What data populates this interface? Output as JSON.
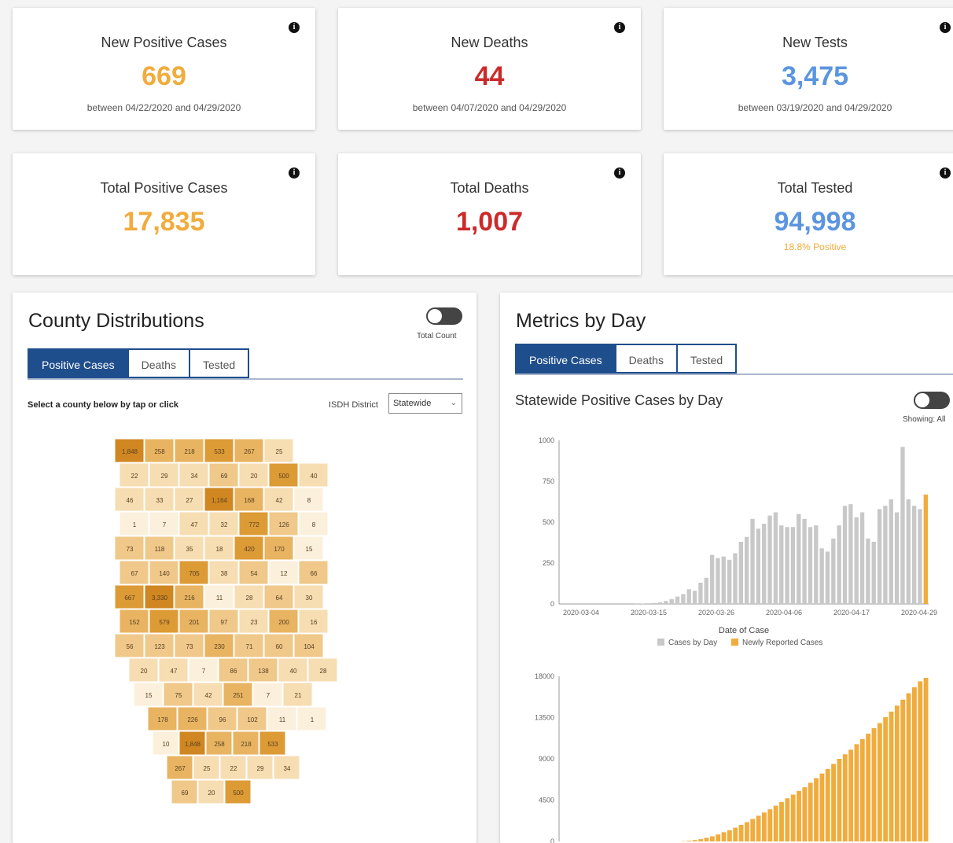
{
  "stats": [
    {
      "title": "New Positive Cases",
      "value": "669",
      "sub": "between 04/22/2020 and 04/29/2020",
      "color": "#f0ac3c"
    },
    {
      "title": "New Deaths",
      "value": "44",
      "sub": "between 04/07/2020 and 04/29/2020",
      "color": "#cc2a2a"
    },
    {
      "title": "New Tests",
      "value": "3,475",
      "sub": "between 03/19/2020 and 04/29/2020",
      "color": "#5b95e0"
    },
    {
      "title": "Total Positive Cases",
      "value": "17,835",
      "sub": "",
      "color": "#f0ac3c"
    },
    {
      "title": "Total Deaths",
      "value": "1,007",
      "sub": "",
      "color": "#cc2a2a"
    },
    {
      "title": "Total Tested",
      "value": "94,998",
      "sub": "18.8% Positive",
      "color": "#5b95e0"
    }
  ],
  "info_icon": "i",
  "county": {
    "title": "County Distributions",
    "toggle_label": "Total Count",
    "tabs": [
      "Positive Cases",
      "Deaths",
      "Tested"
    ],
    "active_tab": 0,
    "instruction": "Select a county below by tap or click",
    "district_label": "ISDH District",
    "district_value": "Statewide",
    "map_labels": [
      "1,848",
      "258",
      "218",
      "533",
      "267",
      "25",
      "22",
      "29",
      "34",
      "69",
      "20",
      "500",
      "40",
      "46",
      "33",
      "27",
      "1,164",
      "168",
      "42",
      "8",
      "1",
      "7",
      "47",
      "32",
      "772",
      "126",
      "8",
      "73",
      "118",
      "35",
      "18",
      "420",
      "170",
      "15",
      "67",
      "140",
      "705",
      "38",
      "54",
      "12",
      "66",
      "667",
      "3,330",
      "216",
      "11",
      "28",
      "64",
      "30",
      "152",
      "579",
      "201",
      "97",
      "23",
      "200",
      "16",
      "56",
      "123",
      "73",
      "230",
      "71",
      "60",
      "104",
      "20",
      "47",
      "7",
      "86",
      "138",
      "40",
      "28",
      "15",
      "75",
      "42",
      "251",
      "7",
      "21",
      "178",
      "226",
      "96",
      "102",
      "11",
      "1",
      "10"
    ]
  },
  "metrics": {
    "title": "Metrics by Day",
    "tabs": [
      "Positive Cases",
      "Deaths",
      "Tested"
    ],
    "active_tab": 0,
    "chart_title": "Statewide Positive Cases by Day",
    "toggle_label": "Showing: All"
  },
  "chart_data": [
    {
      "type": "bar",
      "title": "Statewide Positive Cases by Day",
      "xlabel": "Date of Case",
      "ylabel": "",
      "ylim": [
        0,
        1000
      ],
      "yticks": [
        0,
        250,
        500,
        750,
        1000
      ],
      "xticks": [
        "2020-03-04",
        "2020-03-15",
        "2020-03-26",
        "2020-04-06",
        "2020-04-17",
        "2020-04-29"
      ],
      "x_start": "2020-03-02",
      "x_end": "2020-04-29",
      "series": [
        {
          "name": "Cases by Day",
          "color": "#c8c8c8",
          "values": [
            0,
            0,
            0,
            0,
            0,
            0,
            0,
            0,
            0,
            0,
            0,
            0,
            0,
            1,
            2,
            4,
            6,
            10,
            18,
            30,
            45,
            60,
            90,
            80,
            130,
            160,
            300,
            280,
            290,
            270,
            310,
            380,
            410,
            520,
            460,
            490,
            540,
            560,
            480,
            470,
            470,
            550,
            520,
            470,
            480,
            340,
            320,
            400,
            480,
            600,
            610,
            530,
            560,
            400,
            380,
            580,
            600,
            640,
            560,
            960,
            640,
            600,
            580,
            0
          ],
          "bar_count": 64
        },
        {
          "name": "Newly Reported Cases",
          "color": "#f0ac3c",
          "values": [
            0,
            0,
            0,
            0,
            0,
            0,
            0,
            0,
            0,
            0,
            0,
            0,
            0,
            0,
            0,
            0,
            0,
            0,
            0,
            0,
            0,
            0,
            0,
            0,
            0,
            0,
            0,
            0,
            0,
            0,
            0,
            0,
            0,
            0,
            0,
            0,
            0,
            0,
            0,
            0,
            0,
            0,
            0,
            0,
            0,
            0,
            0,
            0,
            0,
            0,
            0,
            0,
            0,
            0,
            0,
            0,
            0,
            0,
            0,
            0,
            0,
            0,
            0,
            669
          ]
        }
      ],
      "legend": "bottom"
    },
    {
      "type": "bar",
      "title": "",
      "xlabel": "",
      "ylabel": "",
      "ylim": [
        0,
        18000
      ],
      "yticks": [
        0,
        4500,
        9000,
        13500,
        18000
      ],
      "color": "#f0ac3c",
      "values": [
        0,
        0,
        0,
        0,
        0,
        0,
        0,
        0,
        0,
        0,
        0,
        0,
        0,
        0,
        0,
        0,
        0,
        0,
        0,
        0,
        0,
        30,
        80,
        150,
        250,
        400,
        560,
        760,
        1000,
        1230,
        1500,
        1800,
        2100,
        2450,
        2800,
        3150,
        3500,
        3900,
        4300,
        4700,
        5100,
        5500,
        5900,
        6400,
        6900,
        7400,
        7900,
        8450,
        9000,
        9500,
        10000,
        10600,
        11150,
        11750,
        12350,
        12900,
        13550,
        14150,
        14800,
        15450,
        16150,
        16800,
        17450,
        17835
      ]
    }
  ]
}
